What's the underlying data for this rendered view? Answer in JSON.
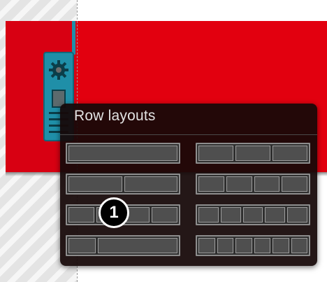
{
  "popup": {
    "title": "Row layouts",
    "layouts": [
      {
        "name": "layout-1-col",
        "columns": [
          1
        ]
      },
      {
        "name": "layout-3-col",
        "columns": [
          1,
          1,
          1
        ]
      },
      {
        "name": "layout-2-col",
        "columns": [
          1,
          1
        ]
      },
      {
        "name": "layout-4-col",
        "columns": [
          1,
          1,
          1,
          1
        ]
      },
      {
        "name": "layout-4-col-alt",
        "columns": [
          1,
          1,
          1,
          1
        ]
      },
      {
        "name": "layout-5-col",
        "columns": [
          1,
          1,
          1,
          1,
          1
        ]
      },
      {
        "name": "layout-1-4",
        "columns": [
          1,
          3
        ]
      },
      {
        "name": "layout-6-col",
        "columns": [
          1,
          1,
          1,
          1,
          1,
          1
        ]
      }
    ]
  },
  "callout": {
    "number": "1"
  },
  "toolbar": {
    "icons": [
      "gear-icon",
      "column-icon",
      "lines-icon"
    ]
  },
  "colors": {
    "band": "#e2000f",
    "toolbar": "#1f8fa8",
    "popup": "#160808"
  }
}
